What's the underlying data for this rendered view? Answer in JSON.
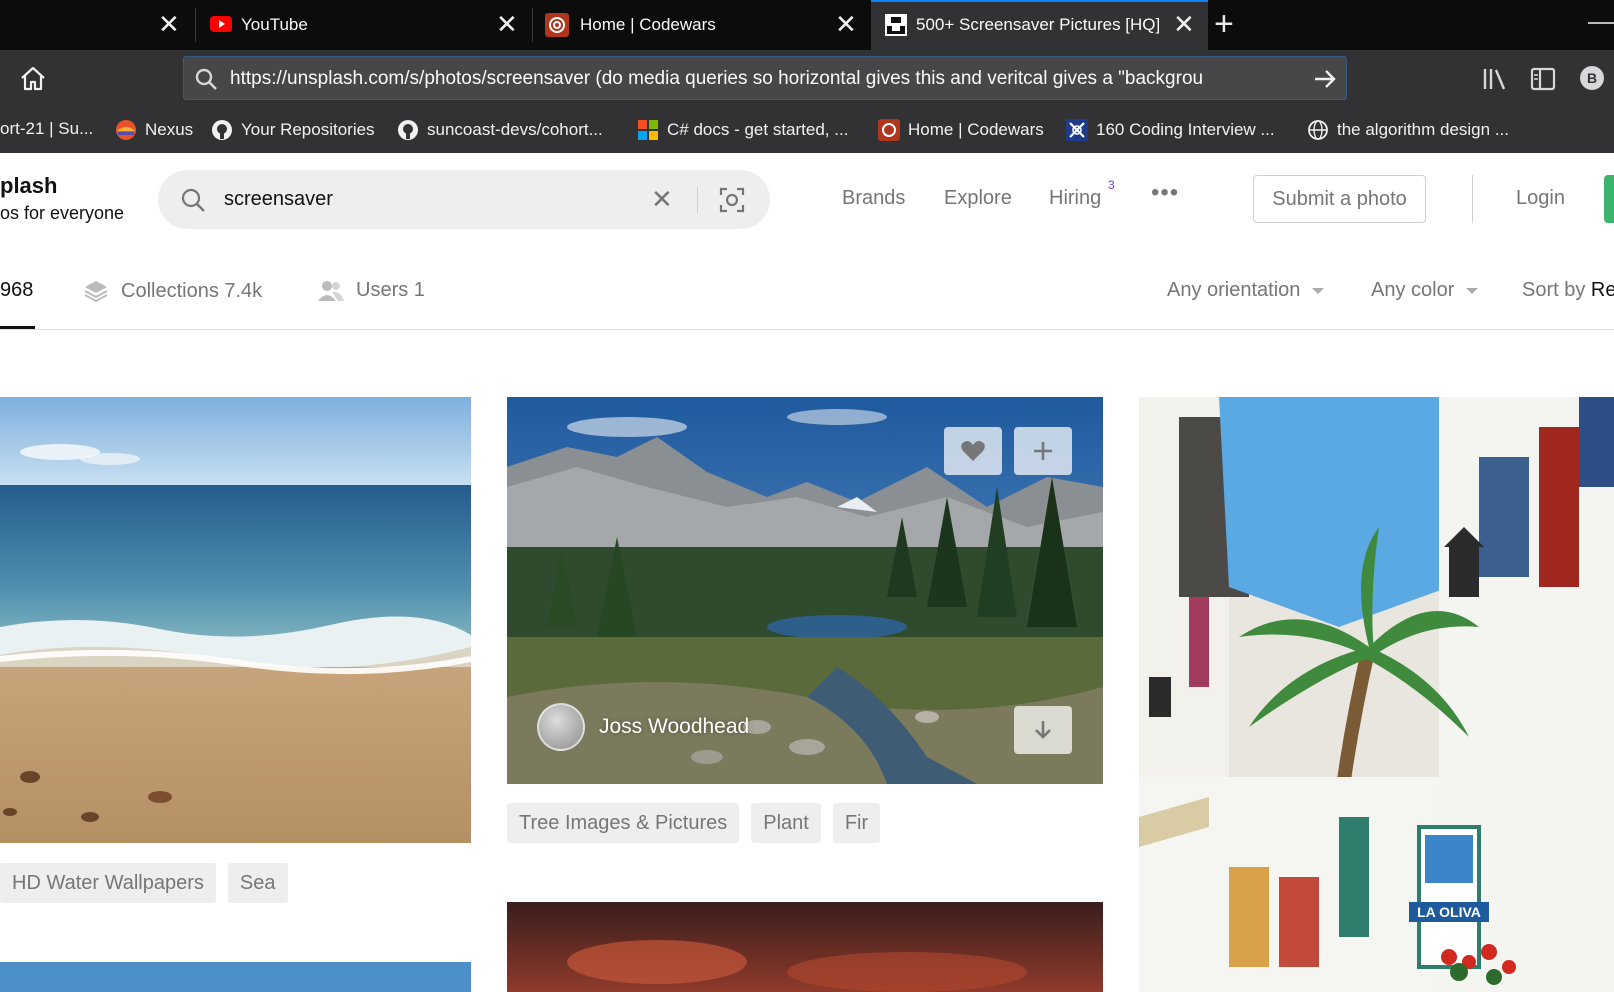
{
  "browser": {
    "tabs": [
      {
        "label": "",
        "close": "✕"
      },
      {
        "label": "YouTube",
        "close": "✕"
      },
      {
        "label": "Home | Codewars",
        "close": "✕"
      },
      {
        "label": "500+ Screensaver Pictures [HQ]",
        "close": "✕",
        "active": true
      }
    ],
    "new_tab": "+",
    "url": "https://unsplash.com/s/photos/screensaver (do media queries so horizontal gives this and veritcal gives a \"backgrou",
    "profile_letter": "B",
    "bookmarks": [
      {
        "label": "ort-21 | Su..."
      },
      {
        "label": "Nexus"
      },
      {
        "label": "Your Repositories"
      },
      {
        "label": "suncoast-devs/cohort..."
      },
      {
        "label": "C# docs - get started, ..."
      },
      {
        "label": "Home | Codewars"
      },
      {
        "label": "160 Coding Interview ..."
      },
      {
        "label": "the algorithm design ..."
      }
    ]
  },
  "header": {
    "brand_title": "plash",
    "brand_subtitle": "os for everyone",
    "search_value": "screensaver",
    "nav": {
      "brands": "Brands",
      "explore": "Explore",
      "hiring": "Hiring",
      "hiring_badge": "3",
      "more": "•••"
    },
    "submit_label": "Submit a photo",
    "login_label": "Login"
  },
  "subnav": {
    "photos_count": "968",
    "collections": "Collections 7.4k",
    "users": "Users 1",
    "orientation": "Any orientation",
    "color": "Any color",
    "sort_prefix": "Sort by",
    "sort_value": "Re"
  },
  "grid": {
    "col1_tags": [
      "HD Water Wallpapers",
      "Sea"
    ],
    "col2_author": "Joss Woodhead",
    "col2_tags": [
      "Tree Images & Pictures",
      "Plant",
      "Fir"
    ],
    "col3_sign_text": "LA OLIVA"
  }
}
